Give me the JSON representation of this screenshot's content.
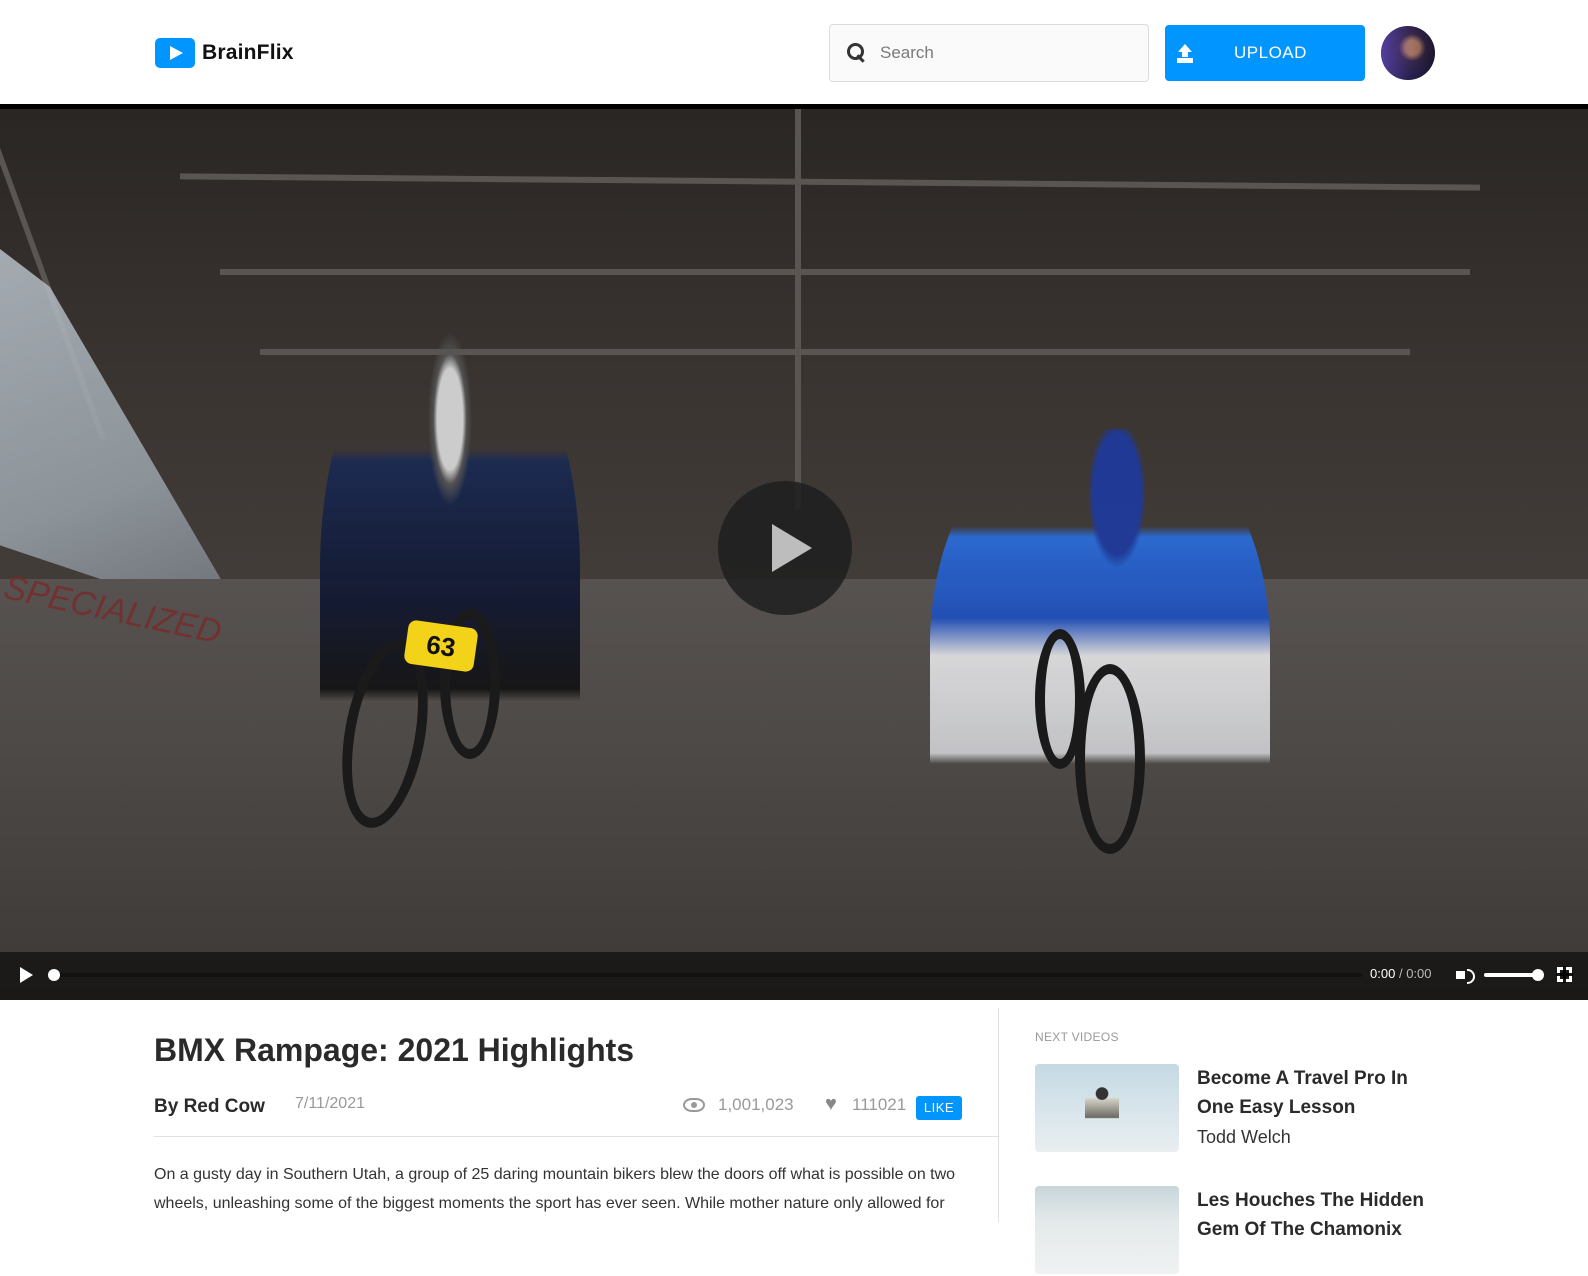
{
  "app": {
    "name": "BrainFlix"
  },
  "header": {
    "search_placeholder": "Search",
    "upload_label": "UPLOAD"
  },
  "player": {
    "current_time": "0:00",
    "separator": "/",
    "duration": "0:00",
    "progress": 0,
    "volume": 1.0,
    "number_plate": "63"
  },
  "video": {
    "title": "BMX Rampage: 2021 Highlights",
    "channel": "By Red Cow",
    "date": "7/11/2021",
    "views": "1,001,023",
    "likes": "111021",
    "like_label": "LIKE",
    "description": "On a gusty day in Southern Utah, a group of 25 daring mountain bikers blew the doors off what is possible on two wheels, unleashing some of the biggest moments the sport has ever seen. While mother nature only allowed for"
  },
  "sidebar": {
    "heading": "NEXT VIDEOS",
    "items": [
      {
        "title": "Become A Travel Pro In One Easy Lesson",
        "author": "Todd Welch"
      },
      {
        "title": "Les Houches The Hidden Gem Of The Chamonix",
        "author": ""
      }
    ]
  },
  "colors": {
    "accent": "#0095ff",
    "text": "#323232",
    "muted": "#999999",
    "divider": "#e1e1e1"
  },
  "icons": [
    "play-logo-icon",
    "search-icon",
    "upload-icon",
    "eye-icon",
    "heart-icon",
    "play-icon",
    "volume-icon",
    "fullscreen-icon"
  ]
}
